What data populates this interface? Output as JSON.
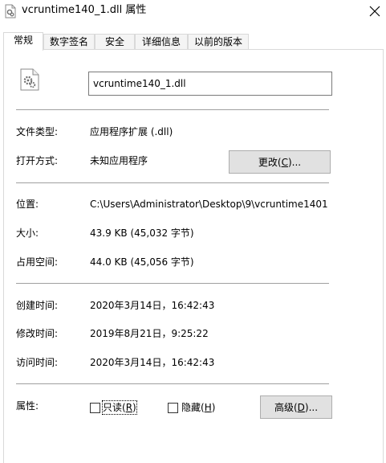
{
  "window": {
    "title": "vcruntime140_1.dll 属性"
  },
  "tabs": [
    {
      "label": "常规",
      "active": true
    },
    {
      "label": "数字签名",
      "active": false
    },
    {
      "label": "安全",
      "active": false
    },
    {
      "label": "详细信息",
      "active": false
    },
    {
      "label": "以前的版本",
      "active": false
    }
  ],
  "general": {
    "file_name": "vcruntime140_1.dll",
    "file_type_label": "文件类型:",
    "file_type_value": "应用程序扩展 (.dll)",
    "opens_with_label": "打开方式:",
    "opens_with_value": "未知应用程序",
    "change_button_prefix": "更改(",
    "change_button_key": "C",
    "change_button_suffix": ")...",
    "location_label": "位置:",
    "location_value": "C:\\Users\\Administrator\\Desktop\\9\\vcruntime1401",
    "size_label": "大小:",
    "size_value": "43.9 KB (45,032 字节)",
    "size_on_disk_label": "占用空间:",
    "size_on_disk_value": "44.0 KB (45,056 字节)",
    "created_label": "创建时间:",
    "created_value": "2020年3月14日，16:42:43",
    "modified_label": "修改时间:",
    "modified_value": "2019年8月21日，9:25:22",
    "accessed_label": "访问时间:",
    "accessed_value": "2020年3月14日，16:42:43",
    "attributes_label": "属性:",
    "readonly_text": "只读(",
    "readonly_key": "R",
    "readonly_suffix": ")",
    "readonly_checked": false,
    "hidden_text": "隐藏(",
    "hidden_key": "H",
    "hidden_suffix": ")",
    "hidden_checked": false,
    "advanced_prefix": "高级(",
    "advanced_key": "D",
    "advanced_suffix": ")..."
  },
  "icons": {
    "app": "dll-file-icon",
    "file": "dll-gear-file-icon",
    "close": "close-icon"
  }
}
